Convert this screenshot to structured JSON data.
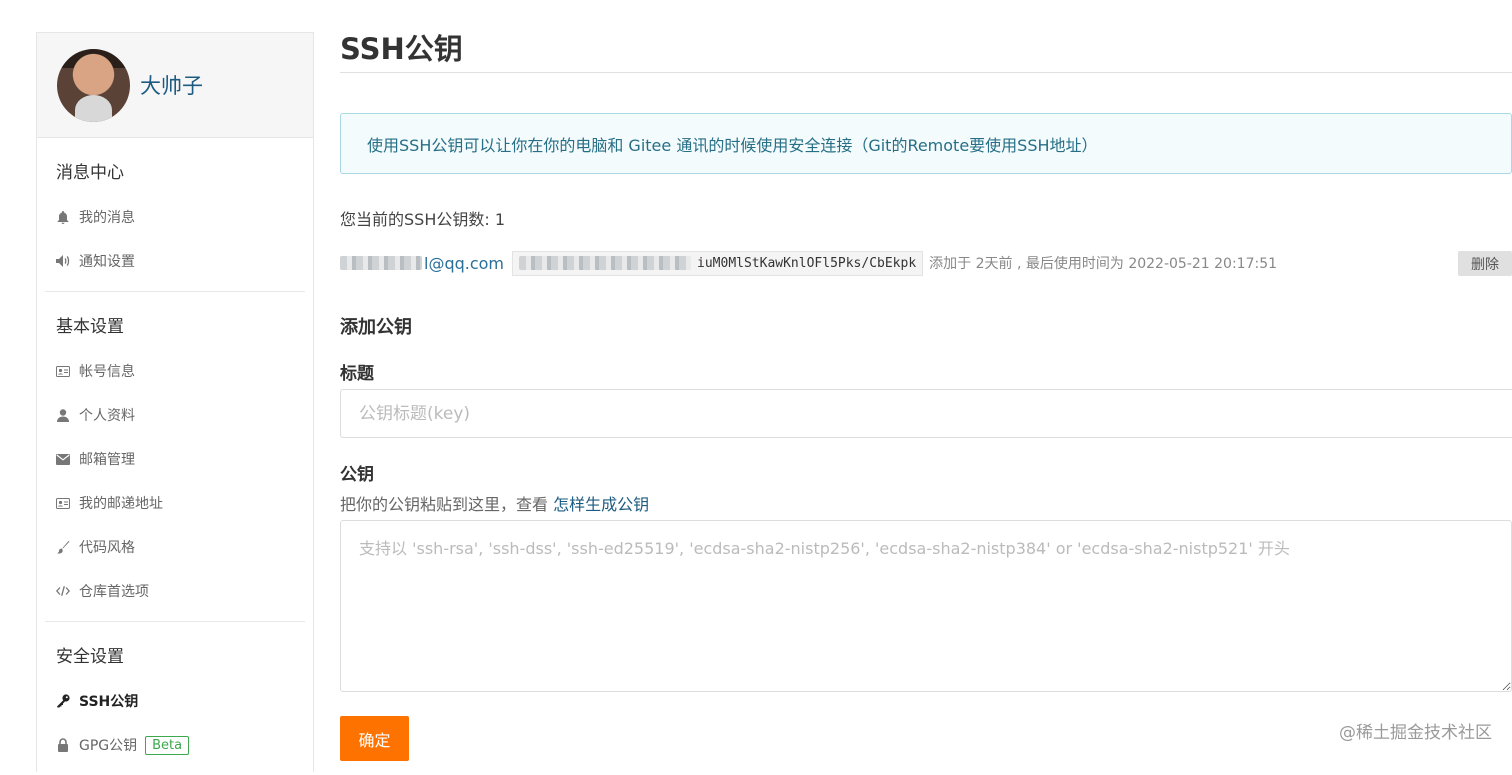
{
  "profile": {
    "name": "大帅子"
  },
  "sidebar": {
    "groups": [
      {
        "title": "消息中心",
        "items": [
          {
            "label": "我的消息",
            "icon": "bell-icon"
          },
          {
            "label": "通知设置",
            "icon": "speaker-icon"
          }
        ]
      },
      {
        "title": "基本设置",
        "items": [
          {
            "label": "帐号信息",
            "icon": "id-card-icon"
          },
          {
            "label": "个人资料",
            "icon": "user-icon"
          },
          {
            "label": "邮箱管理",
            "icon": "envelope-icon"
          },
          {
            "label": "我的邮递地址",
            "icon": "address-card-icon"
          },
          {
            "label": "代码风格",
            "icon": "brush-icon"
          },
          {
            "label": "仓库首选项",
            "icon": "code-icon"
          }
        ]
      },
      {
        "title": "安全设置",
        "items": [
          {
            "label": "SSH公钥",
            "icon": "key-icon",
            "active": true
          },
          {
            "label": "GPG公钥",
            "icon": "lock-icon",
            "badge": "Beta"
          }
        ]
      }
    ]
  },
  "page": {
    "title": "SSH公钥",
    "info": "使用SSH公钥可以让你在你的电脑和 Gitee 通讯的时候使用安全连接（Git的Remote要使用SSH地址）",
    "count_text": "您当前的SSH公钥数: 1",
    "key": {
      "email_visible": "l@qq.com",
      "fingerprint_visible": "iuM0MlStKawKnlOFl5Pks/CbEkpk",
      "meta": "添加于 2天前 , 最后使用时间为 2022-05-21 20:17:51",
      "delete_label": "删除"
    },
    "add_title": "添加公钥",
    "title_label": "标题",
    "title_placeholder": "公钥标题(key)",
    "key_label": "公钥",
    "key_hint": "把你的公钥粘贴到这里，查看",
    "key_hint_link": "怎样生成公钥",
    "key_placeholder": "支持以 'ssh-rsa', 'ssh-dss', 'ssh-ed25519', 'ecdsa-sha2-nistp256', 'ecdsa-sha2-nistp384' or 'ecdsa-sha2-nistp521' 开头",
    "submit_label": "确定"
  },
  "watermark": "@稀土掘金技术社区"
}
